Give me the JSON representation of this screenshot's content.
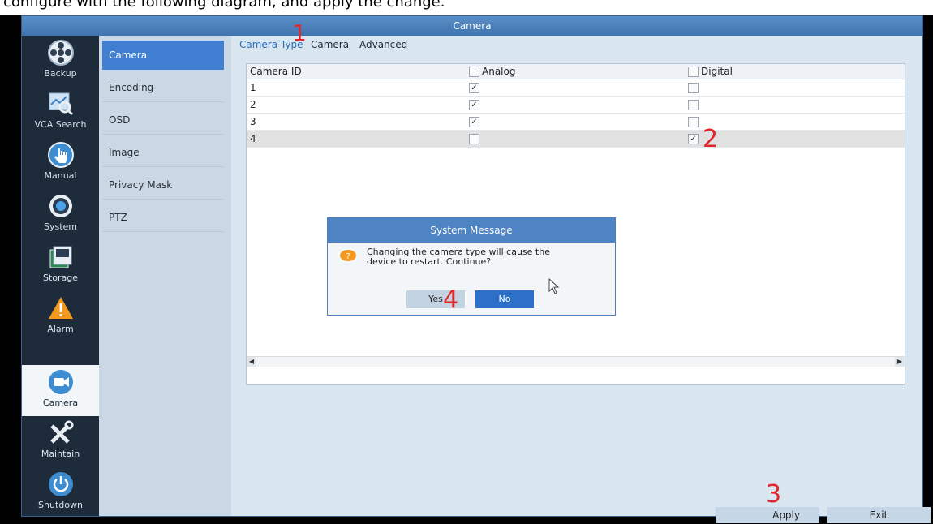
{
  "caption": "configure with the following diagram, and apply the change.",
  "window_title": "Camera",
  "sidebar": {
    "items": [
      {
        "label": "Backup",
        "icon": "backup-reel-icon"
      },
      {
        "label": "VCA Search",
        "icon": "vca-search-icon"
      },
      {
        "label": "Manual",
        "icon": "manual-hand-icon"
      },
      {
        "label": "System",
        "icon": "system-gear-icon"
      },
      {
        "label": "Storage",
        "icon": "storage-icon"
      },
      {
        "label": "Alarm",
        "icon": "alarm-warning-icon"
      },
      {
        "label": "Camera",
        "icon": "camera-icon",
        "active": true
      },
      {
        "label": "Maintain",
        "icon": "maintain-tools-icon"
      },
      {
        "label": "Shutdown",
        "icon": "power-icon"
      }
    ]
  },
  "submenu": {
    "items": [
      "Camera",
      "Encoding",
      "OSD",
      "Image",
      "Privacy Mask",
      "PTZ"
    ],
    "active": "Camera"
  },
  "tabs": {
    "items": [
      "Camera Type",
      "Camera",
      "Advanced"
    ],
    "active": "Camera Type"
  },
  "table": {
    "headers": {
      "id": "Camera ID",
      "analog": "Analog",
      "digital": "Digital"
    },
    "rows": [
      {
        "id": "1",
        "analog": true,
        "digital": false
      },
      {
        "id": "2",
        "analog": true,
        "digital": false
      },
      {
        "id": "3",
        "analog": true,
        "digital": false
      },
      {
        "id": "4",
        "analog": false,
        "digital": true
      }
    ]
  },
  "dialog": {
    "title": "System Message",
    "message_line1": "Changing the camera type will cause the",
    "message_line2": "device to restart. Continue?",
    "yes_label": "Yes",
    "no_label": "No"
  },
  "footer": {
    "apply_label": "Apply",
    "exit_label": "Exit"
  },
  "annotations": {
    "n1": "1",
    "n2": "2",
    "n3": "3",
    "n4": "4"
  },
  "colors": {
    "accent": "#3f7ed0",
    "annotation": "#e3262b",
    "titlebar": "#4a80be"
  }
}
